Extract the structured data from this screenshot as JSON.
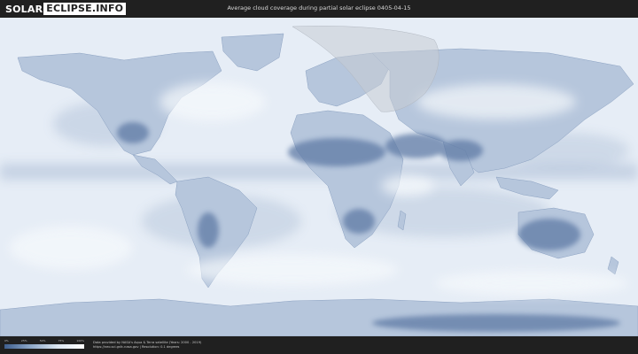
{
  "header": {
    "logo_left": "SOLAR",
    "logo_right": "ECLIPSE.INFO",
    "title": "Average cloud coverage during partial solar eclipse 0405-04-15"
  },
  "legend": {
    "ticks": [
      "0%",
      "25%",
      "50%",
      "75%",
      "100%"
    ],
    "colors": [
      "#3f5f8e",
      "#8ea8c8",
      "#dbe5f0",
      "#ffffff"
    ]
  },
  "footer": {
    "source_line1": "Data provided by NASA's Aqua & Terra satellite (Years: 2000 - 2019)",
    "source_line2": "https://neo.sci.gsfc.nasa.gov | Resolution: 0.1 degrees"
  },
  "map": {
    "eclipse_shadow_color": "#c7ccd3",
    "low_cloud_color": "#6f8ab2",
    "high_cloud_color": "#f4f7fb"
  }
}
